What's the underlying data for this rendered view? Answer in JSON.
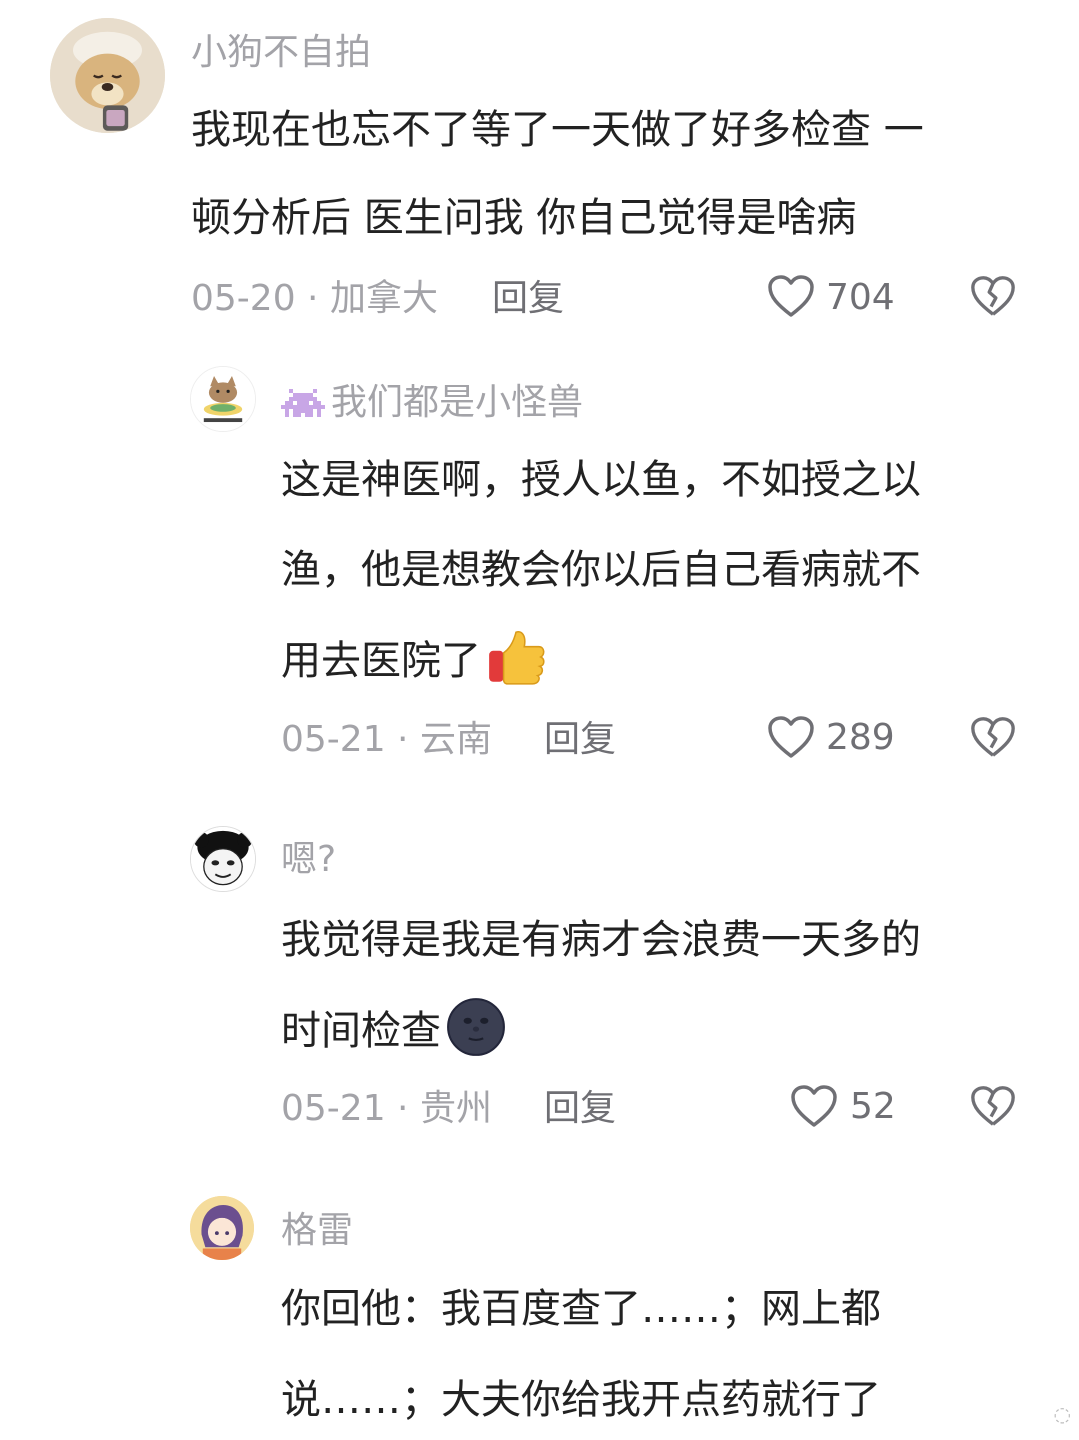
{
  "comments": [
    {
      "user": "小狗不自拍",
      "lines": [
        "我现在也忘不了等了一天做了好多检查 一",
        "顿分析后 医生问我 你自己觉得是啥病"
      ],
      "date_loc": "05-20 · 加拿大",
      "reply": "回复",
      "likes": "704"
    },
    {
      "user": "我们都是小怪兽",
      "lines": [
        "这是神医啊，授人以鱼，不如授之以",
        "渔，他是想教会你以后自己看病就不",
        "用去医院了"
      ],
      "date_loc": "05-21 · 云南",
      "reply": "回复",
      "likes": "289"
    },
    {
      "user": "嗯?",
      "lines": [
        "我觉得是我是有病才会浪费一天多的",
        "时间检查"
      ],
      "date_loc": "05-21 · 贵州",
      "reply": "回复",
      "likes": "52"
    },
    {
      "user": "格雷",
      "lines": [
        "你回他：我百度查了……；网上都",
        "说……；大夫你给我开点药就行了"
      ]
    }
  ],
  "icons": {
    "like": "heart-outline-icon",
    "dislike": "broken-heart-icon",
    "emoji_thumbs": "thumbs-up-emoji",
    "emoji_moon": "new-moon-face-emoji",
    "user_prefix": "alien-monster-icon"
  }
}
